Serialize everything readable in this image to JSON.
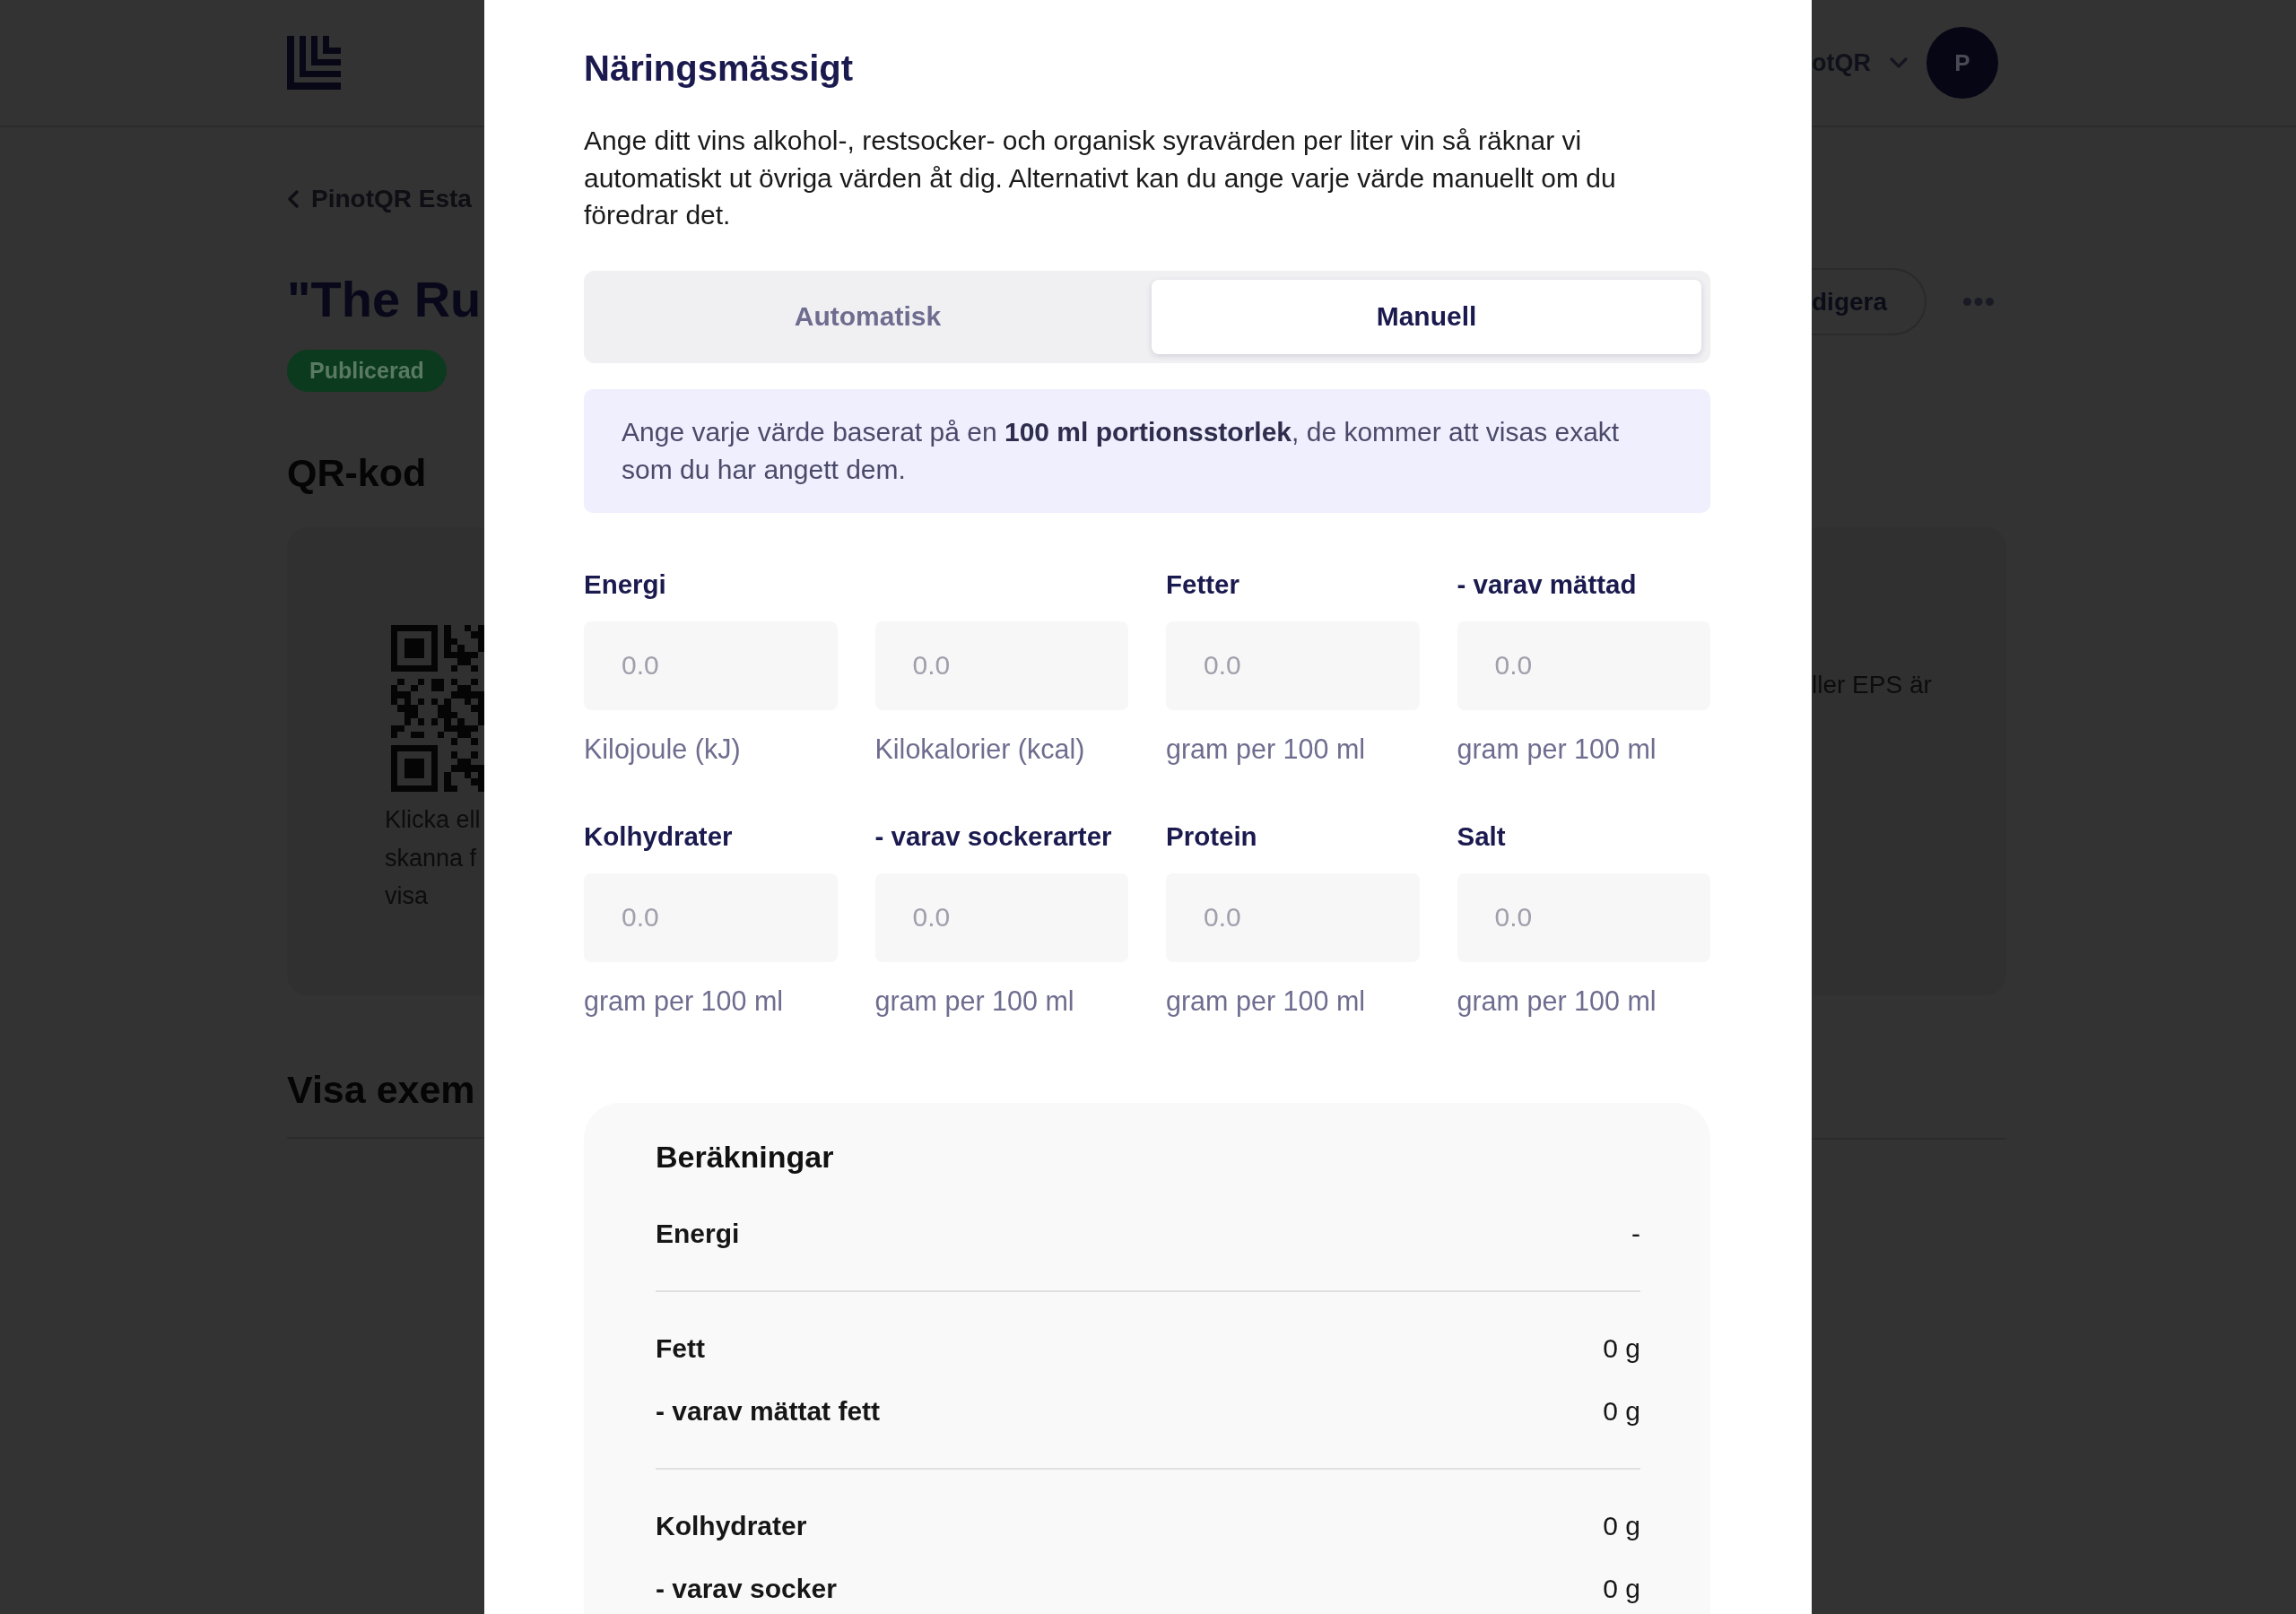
{
  "background_page": {
    "header": {
      "account_name": "otQR",
      "avatar_initial": "P"
    },
    "breadcrumb": "PinotQR Esta",
    "title": "\"The Ru",
    "status_badge": "Publicerad",
    "edit_button": "digera",
    "qr_section": {
      "heading": "QR-kod",
      "caption_lines": [
        "Klicka ell",
        "skanna f",
        "visa"
      ],
      "side_text": "ller EPS är"
    },
    "examples_heading": "Visa exem"
  },
  "modal": {
    "title": "Näringsmässigt",
    "description": "Ange ditt vins alkohol-, restsocker- och organisk syravärden per liter vin så räknar vi automatiskt ut övriga värden åt dig. Alternativt kan du ange varje värde manuellt om du föredrar det.",
    "tabs": [
      {
        "label": "Automatisk",
        "selected": false
      },
      {
        "label": "Manuell",
        "selected": true
      }
    ],
    "info": "Ange varje värde baserat på en **100 ml portionsstorlek**, de kommer att visas exakt som du har angett dem.",
    "fields": [
      {
        "label": "Energi",
        "placeholder": "0.0",
        "unit": "Kilojoule (kJ)"
      },
      {
        "placeholder": "0.0",
        "unit": "Kilokalorier (kcal)"
      },
      {
        "label": "Fetter",
        "placeholder": "0.0",
        "unit": "gram per 100 ml"
      },
      {
        "label": "- varav mättad",
        "placeholder": "0.0",
        "unit": "gram per 100 ml"
      },
      {
        "label": "Kolhydrater",
        "placeholder": "0.0",
        "unit": "gram per 100 ml"
      },
      {
        "label": "- varav sockerarter",
        "placeholder": "0.0",
        "unit": "gram per 100 ml"
      },
      {
        "label": "Protein",
        "placeholder": "0.0",
        "unit": "gram per 100 ml"
      },
      {
        "label": "Salt",
        "placeholder": "0.0",
        "unit": "gram per 100 ml"
      }
    ],
    "calculations": {
      "title": "Beräkningar",
      "groups": [
        {
          "rows": [
            {
              "label": "Energi",
              "value": "-"
            }
          ]
        },
        {
          "rows": [
            {
              "label": "Fett",
              "value": "0 g"
            },
            {
              "label": "- varav mättat fett",
              "value": "0 g"
            }
          ]
        },
        {
          "rows": [
            {
              "label": "Kolhydrater",
              "value": "0 g"
            },
            {
              "label": "- varav socker",
              "value": "0 g"
            }
          ]
        }
      ]
    }
  }
}
